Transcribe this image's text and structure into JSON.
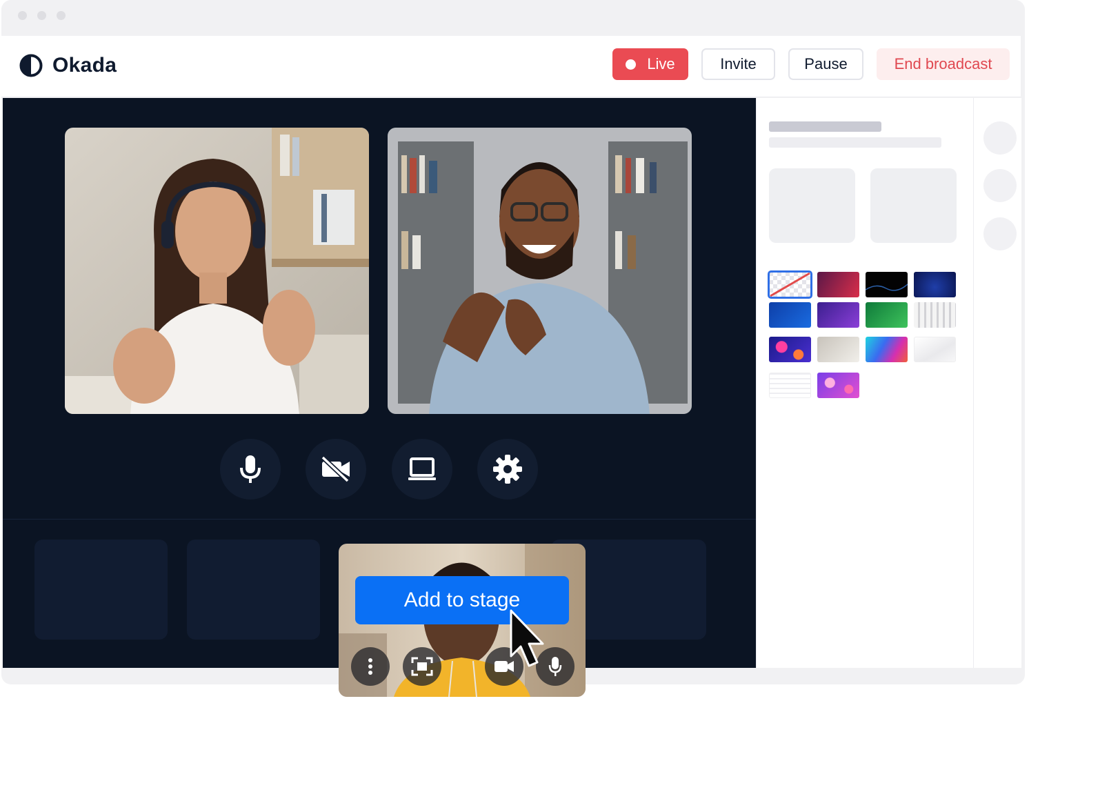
{
  "app": {
    "name": "Okada",
    "logo_icon": "half-circle-logo-icon"
  },
  "header": {
    "live_label": "Live",
    "invite_label": "Invite",
    "pause_label": "Pause",
    "end_label": "End broadcast"
  },
  "colors": {
    "live_bg": "#ea4b53",
    "end_text": "#e04850",
    "stage_bg": "#0b1423",
    "primary": "#0a70f5"
  },
  "stage": {
    "participants": [
      {
        "id": "participant-1",
        "desc_icon": "video-feed"
      },
      {
        "id": "participant-2",
        "desc_icon": "video-feed"
      }
    ],
    "controls": [
      {
        "name": "microphone",
        "icon": "mic-icon"
      },
      {
        "name": "camera",
        "icon": "camera-off-icon"
      },
      {
        "name": "screen-share",
        "icon": "laptop-icon"
      },
      {
        "name": "settings",
        "icon": "gear-icon"
      }
    ]
  },
  "guest": {
    "add_to_stage_label": "Add to stage",
    "actions": [
      "more-icon",
      "frame-icon",
      "camera-icon",
      "mic-icon"
    ]
  },
  "backgrounds": {
    "swatch_icons": [
      "none",
      "crimson",
      "dark-wave",
      "navy",
      "blue",
      "purple",
      "green",
      "white-stripes",
      "neon-bubbles",
      "grey-gradient",
      "rainbow",
      "light-geometric",
      "white-texture",
      "pink-bubbles"
    ],
    "selected_index": 0
  }
}
